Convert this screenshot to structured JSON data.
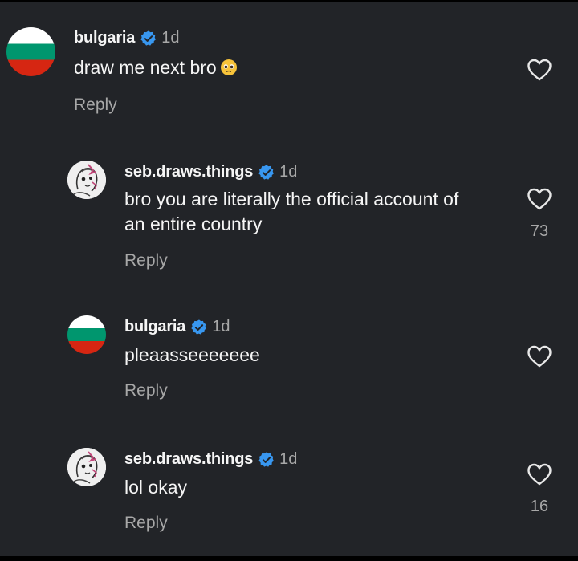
{
  "comments": [
    {
      "username": "bulgaria",
      "time": "1d",
      "text": "draw me next bro",
      "emoji": "pleading-face-icon",
      "reply_label": "Reply",
      "likes": "",
      "avatar": "bulgaria-flag"
    },
    {
      "username": "seb.draws.things",
      "time": "1d",
      "text_lines": [
        "bro you are literally the official account of",
        "an entire country"
      ],
      "reply_label": "Reply",
      "likes": "73",
      "avatar": "sketch-portrait"
    },
    {
      "username": "bulgaria",
      "time": "1d",
      "text": "pleaasseeeeeee",
      "reply_label": "Reply",
      "likes": "",
      "avatar": "bulgaria-flag"
    },
    {
      "username": "seb.draws.things",
      "time": "1d",
      "text": "lol okay",
      "reply_label": "Reply",
      "likes": "16",
      "avatar": "sketch-portrait"
    }
  ],
  "colors": {
    "background": "#222428",
    "text": "#f5f5f5",
    "muted": "#a8a8a8",
    "verified": "#3897f0",
    "flag_white": "#ffffff",
    "flag_green": "#00966e",
    "flag_red": "#d62612"
  }
}
